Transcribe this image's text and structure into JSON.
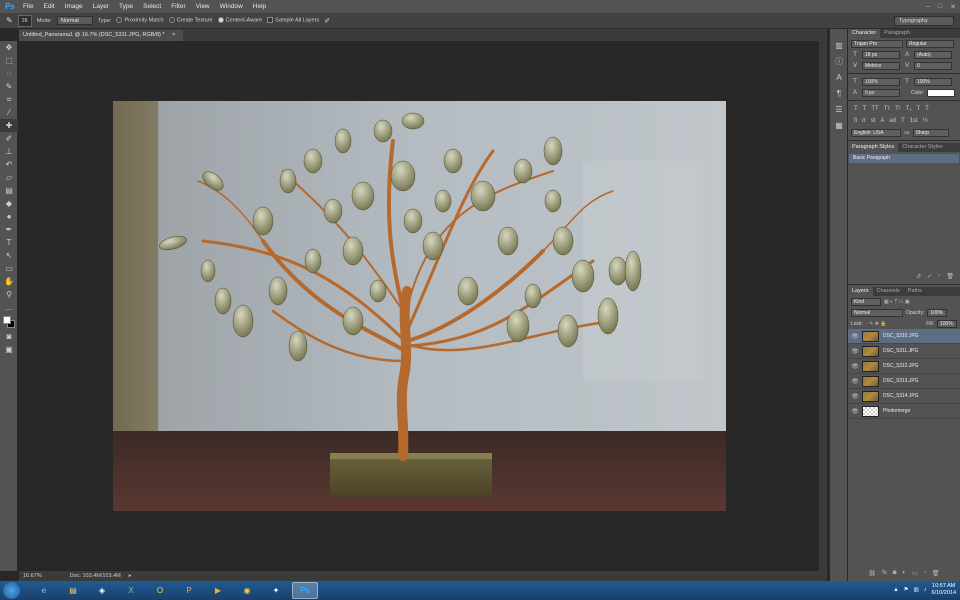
{
  "menubar": {
    "logo": "Ps",
    "items": [
      "File",
      "Edit",
      "Image",
      "Layer",
      "Type",
      "Select",
      "Filter",
      "View",
      "Window",
      "Help"
    ]
  },
  "options": {
    "brush_size": "26",
    "mode_label": "Mode:",
    "mode_value": "Normal",
    "type_label": "Type:",
    "type_options": [
      "Proximity Match",
      "Create Texture",
      "Content-Aware"
    ],
    "type_selected": "Content-Aware",
    "sample_all": "Sample All Layers",
    "workspace": "Typography"
  },
  "document": {
    "tab_title": "Untitled_Panorama1 @ 16.7% (DSC_5311.JPG, RGB/8) *"
  },
  "status": {
    "zoom": "16.67%",
    "doc_size": "Doc: 103.4M/103.4M"
  },
  "character": {
    "tabs": [
      "Character",
      "Paragraph"
    ],
    "font_family": "Trajan Pro",
    "font_style": "Regular",
    "font_size": "18 px",
    "leading": "(Auto)",
    "kerning": "Metrics",
    "tracking": "0",
    "vscale": "100%",
    "hscale": "100%",
    "baseline": "0 px",
    "color_label": "Color:",
    "language": "English: USA",
    "aa_label": "aa",
    "antialias": "Sharp"
  },
  "styles": {
    "tabs": [
      "Paragraph Styles",
      "Character Styles"
    ],
    "item": "Basic Paragraph"
  },
  "layers_panel": {
    "tabs": [
      "Layers",
      "Channels",
      "Paths"
    ],
    "kind": "Kind",
    "blend_mode": "Normal",
    "opacity_label": "Opacity:",
    "opacity": "100%",
    "lock_label": "Lock:",
    "fill_label": "Fill:",
    "fill": "100%",
    "layers": [
      {
        "name": "DSC_5310.JPG",
        "selected": true
      },
      {
        "name": "DSC_5311.JPG",
        "selected": false
      },
      {
        "name": "DSC_5312.JPG",
        "selected": false
      },
      {
        "name": "DSC_5313.JPG",
        "selected": false
      },
      {
        "name": "DSC_5314.JPG",
        "selected": false
      },
      {
        "name": "Photomerge",
        "selected": false
      }
    ]
  },
  "taskbar": {
    "time": "10:57 AM",
    "date": "6/10/2014"
  },
  "colors": {
    "accent": "#31a8ff",
    "selection": "#5d6d84"
  }
}
